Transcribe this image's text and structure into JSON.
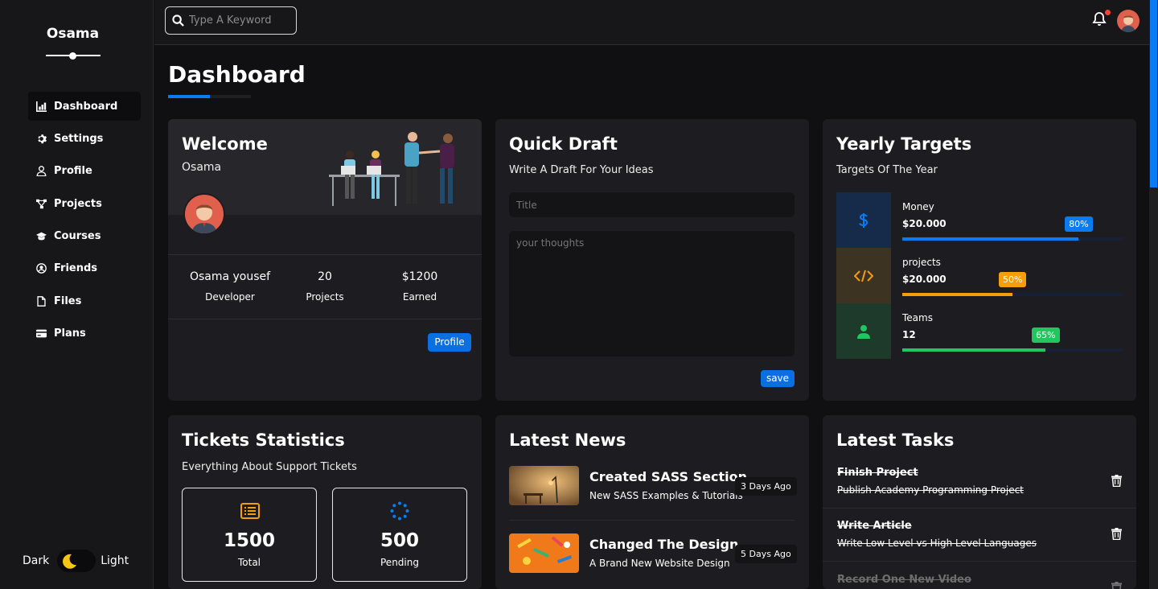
{
  "app": {
    "brand": "Osama"
  },
  "sidebar": {
    "items": [
      {
        "label": "Dashboard",
        "icon": "chart-icon"
      },
      {
        "label": "Settings",
        "icon": "gear-icon"
      },
      {
        "label": "Profile",
        "icon": "user-icon"
      },
      {
        "label": "Projects",
        "icon": "diagram-icon"
      },
      {
        "label": "Courses",
        "icon": "graduation-cap-icon"
      },
      {
        "label": "Friends",
        "icon": "user-circle-icon"
      },
      {
        "label": "Files",
        "icon": "file-icon"
      },
      {
        "label": "Plans",
        "icon": "credit-card-icon"
      }
    ],
    "theme": {
      "dark_label": "Dark",
      "light_label": "Light"
    }
  },
  "header": {
    "search_placeholder": "Type A Keyword"
  },
  "page": {
    "title": "Dashboard"
  },
  "welcome": {
    "title": "Welcome",
    "subtitle": "Osama",
    "stats": [
      {
        "value": "Osama yousef",
        "label": "Developer"
      },
      {
        "value": "20",
        "label": "Projects"
      },
      {
        "value": "$1200",
        "label": "Earned"
      }
    ],
    "button": "Profile"
  },
  "draft": {
    "title": "Quick Draft",
    "subtitle": "Write A Draft For Your Ideas",
    "title_placeholder": "Title",
    "body_placeholder": "your thoughts",
    "button": "save"
  },
  "targets": {
    "title": "Yearly Targets",
    "subtitle": "Targets Of The Year",
    "items": [
      {
        "label": "Money",
        "value": "$20.000",
        "percent": "80%",
        "fraction": 0.8,
        "color": "#0a7bf0",
        "bg": "#162a4a",
        "icon": "dollar-icon"
      },
      {
        "label": "projects",
        "value": "$20.000",
        "percent": "50%",
        "fraction": 0.5,
        "color": "#f59e0b",
        "bg": "#3d3322",
        "icon": "code-icon"
      },
      {
        "label": "Teams",
        "value": "12",
        "percent": "65%",
        "fraction": 0.65,
        "color": "#22c55e",
        "bg": "#1e3a2b",
        "icon": "user-icon"
      }
    ]
  },
  "tickets": {
    "title": "Tickets Statistics",
    "subtitle": "Everything About Support Tickets",
    "boxes": [
      {
        "value": "1500",
        "label": "Total",
        "icon": "list-icon",
        "color": "#f59e0b"
      },
      {
        "value": "500",
        "label": "Pending",
        "icon": "spinner-icon",
        "color": "#0a7bf0"
      }
    ]
  },
  "news": {
    "title": "Latest News",
    "items": [
      {
        "title": "Created SASS Section",
        "desc": "New SASS Examples & Tutorials",
        "date": "3 Days Ago"
      },
      {
        "title": "Changed The Design",
        "desc": "A Brand New Website Design",
        "date": "5 Days Ago"
      }
    ]
  },
  "tasks": {
    "title": "Latest Tasks",
    "items": [
      {
        "title": "Finish Project",
        "desc": "Publish Academy Programming Project"
      },
      {
        "title": "Write Article",
        "desc": "Write Low Level vs High Level Languages"
      },
      {
        "title": "Record One New Video",
        "desc": ""
      }
    ]
  }
}
